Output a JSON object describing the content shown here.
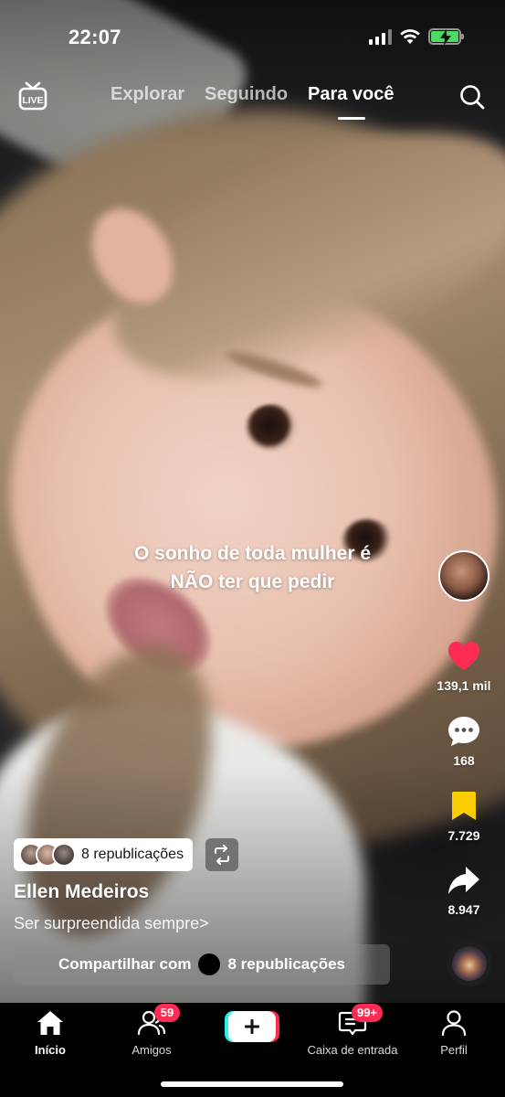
{
  "status_bar": {
    "time": "22:07"
  },
  "top_nav": {
    "live_icon": "live-tv-icon",
    "tabs": [
      {
        "label": "Explorar",
        "active": false
      },
      {
        "label": "Seguindo",
        "active": false
      },
      {
        "label": "Para você",
        "active": true
      }
    ],
    "search_icon": "search-icon"
  },
  "video": {
    "caption_lines": [
      "O sonho de toda mulher é",
      "NÃO ter que pedir"
    ]
  },
  "actions": {
    "likes": "139,1 mil",
    "comments": "168",
    "favorites": "7.729",
    "shares": "8.947",
    "colors": {
      "like": "#fe2c55",
      "favorite": "#facd00"
    }
  },
  "post": {
    "repost_chip_label": "8 republicações",
    "username": "Ellen Medeiros",
    "description": "Ser surpreendida sempre>",
    "share_bar": {
      "prefix": "Compartilhar com",
      "suffix": "8 republicações"
    }
  },
  "tab_bar": {
    "items": [
      {
        "label": "Início",
        "icon": "home-icon",
        "active": true
      },
      {
        "label": "Amigos",
        "icon": "friends-icon",
        "badge": "59"
      },
      {
        "label": "",
        "icon": "plus-icon"
      },
      {
        "label": "Caixa de entrada",
        "icon": "inbox-icon",
        "badge": "99+"
      },
      {
        "label": "Perfil",
        "icon": "profile-icon"
      }
    ]
  }
}
